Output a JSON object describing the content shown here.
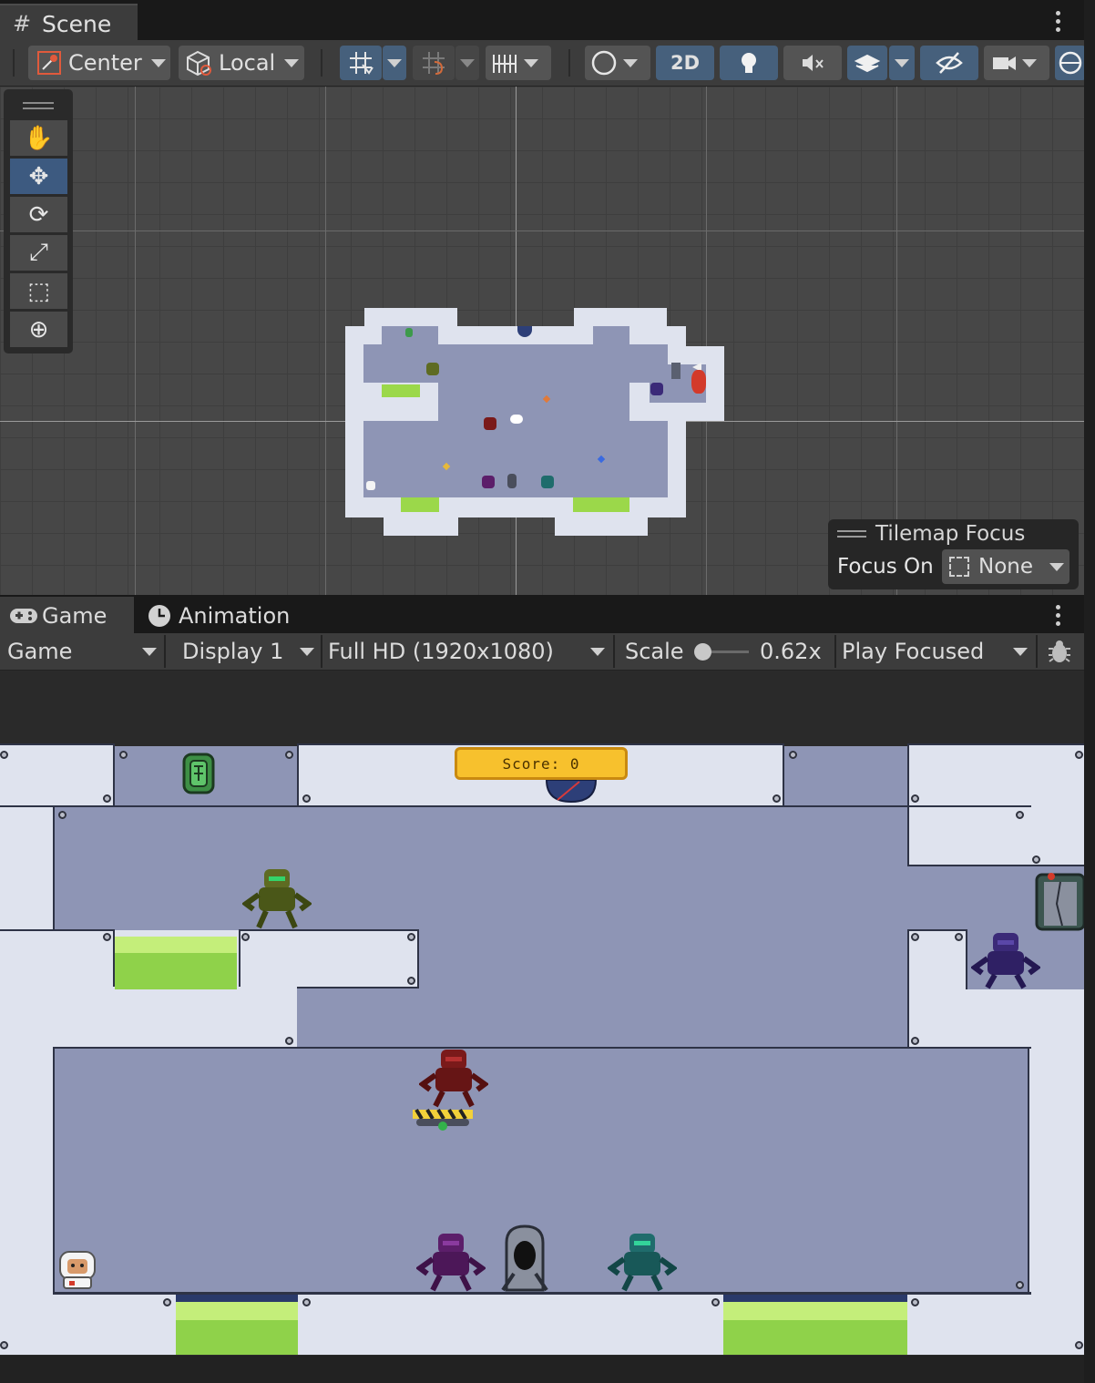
{
  "scene_tab": {
    "label": "Scene",
    "icon": "grid-icon"
  },
  "scene_toolbar": {
    "pivot_mode": "Center",
    "pivot_rotation": "Local",
    "mode_2d": "2D"
  },
  "tilemap_focus": {
    "title": "Tilemap Focus",
    "focus_label": "Focus On",
    "focus_value": "None"
  },
  "game_tabs": {
    "game": "Game",
    "animation": "Animation"
  },
  "game_toolbar": {
    "view_mode": "Game",
    "display": "Display 1",
    "resolution": "Full HD (1920x1080)",
    "scale_label": "Scale",
    "scale_value": "0.62x",
    "play_mode": "Play Focused"
  },
  "game_hud": {
    "score_text": "Score: 0"
  },
  "colors": {
    "accent": "#46607c",
    "wall": "#dfe3ee",
    "floor": "#8e95b5",
    "acid": "#8fd24a",
    "score_plate": "#f7c12d"
  }
}
